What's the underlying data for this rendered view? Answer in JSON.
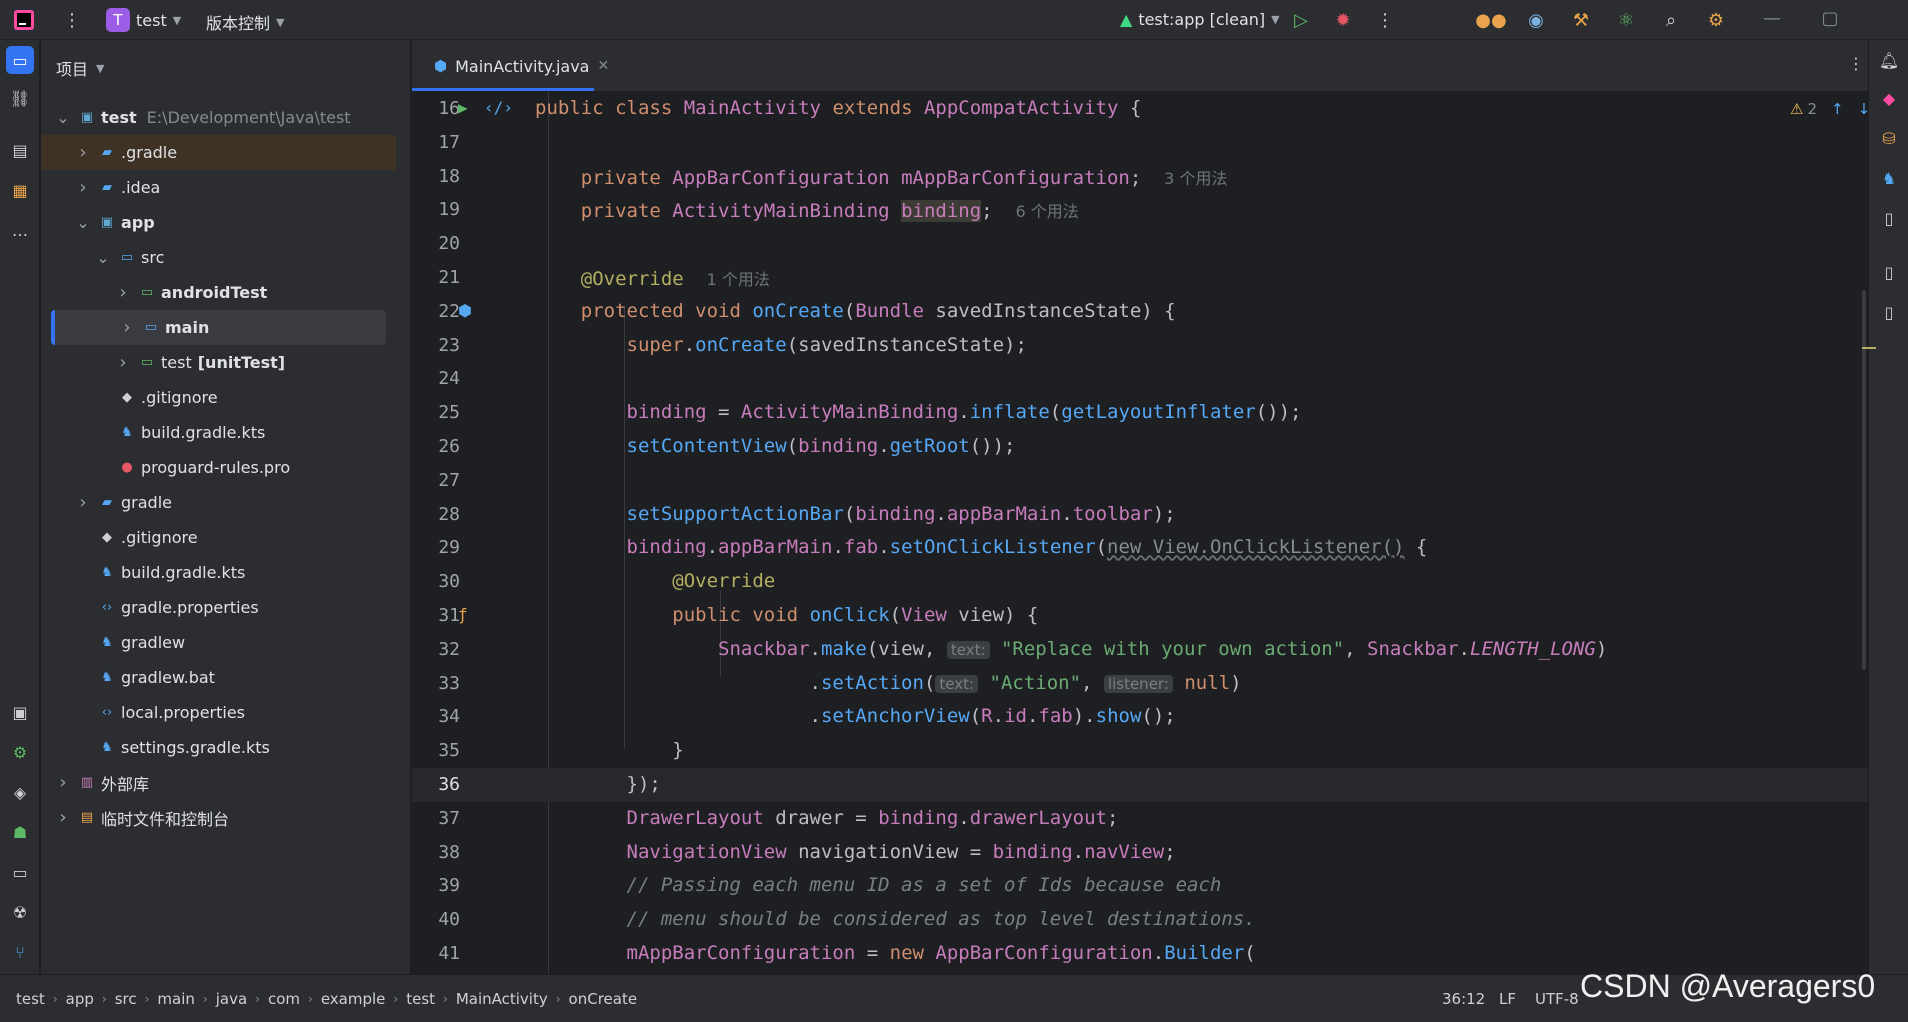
{
  "titlebar": {
    "project_initial": "T",
    "project_name": "test",
    "vcs_label": "版本控制",
    "run_config": "test:app [clean]"
  },
  "project_panel": {
    "title": "项目",
    "rows": [
      {
        "label": "test",
        "hint": "E:\\Development\\Java\\test",
        "depth": 0,
        "expanded": true,
        "bold": true,
        "icon": "module-folder-icon"
      },
      {
        "label": ".gradle",
        "depth": 1,
        "expanded": false,
        "icon": "gradle-folder-icon"
      },
      {
        "label": ".idea",
        "depth": 1,
        "expanded": false,
        "icon": "idea-folder-icon"
      },
      {
        "label": "app",
        "depth": 1,
        "expanded": true,
        "bold": true,
        "icon": "module-folder-icon"
      },
      {
        "label": "src",
        "depth": 2,
        "expanded": true,
        "icon": "source-folder-icon"
      },
      {
        "label": "androidTest",
        "depth": 3,
        "expanded": false,
        "bold": true,
        "icon": "test-folder-icon"
      },
      {
        "label": "main",
        "depth": 3,
        "expanded": false,
        "bold": true,
        "icon": "source-folder-icon"
      },
      {
        "label": "test",
        "hint2": "[unitTest]",
        "depth": 3,
        "expanded": false,
        "icon": "test-folder-icon"
      },
      {
        "label": ".gitignore",
        "depth": 2,
        "icon": "git-file-icon"
      },
      {
        "label": "build.gradle.kts",
        "depth": 2,
        "icon": "gradle-file-icon"
      },
      {
        "label": "proguard-rules.pro",
        "depth": 2,
        "icon": "proguard-file-icon"
      },
      {
        "label": "gradle",
        "depth": 1,
        "expanded": false,
        "icon": "gradle-folder-icon"
      },
      {
        "label": ".gitignore",
        "depth": 1,
        "icon": "git-file-icon"
      },
      {
        "label": "build.gradle.kts",
        "depth": 1,
        "icon": "gradle-file-icon"
      },
      {
        "label": "gradle.properties",
        "depth": 1,
        "icon": "properties-file-icon"
      },
      {
        "label": "gradlew",
        "depth": 1,
        "icon": "gradle-file-icon"
      },
      {
        "label": "gradlew.bat",
        "depth": 1,
        "icon": "gradle-file-icon"
      },
      {
        "label": "local.properties",
        "depth": 1,
        "icon": "properties-file-icon"
      },
      {
        "label": "settings.gradle.kts",
        "depth": 1,
        "icon": "gradle-file-icon"
      },
      {
        "label": "外部库",
        "depth": 0,
        "expanded": false,
        "icon": "library-icon"
      },
      {
        "label": "临时文件和控制台",
        "depth": 0,
        "expanded": false,
        "icon": "scratch-icon"
      }
    ]
  },
  "editor": {
    "tab_label": "MainActivity.java",
    "warning_count": "2",
    "lines": [
      {
        "n": "16",
        "html": "<span class='k'>public class </span><span class='cls'>MainActivity</span><span class='k'> extends </span><span class='cls'>AppCompatActivity</span> {"
      },
      {
        "n": "17",
        "html": ""
      },
      {
        "n": "18",
        "html": "    <span class='k'>private </span><span class='cls'>AppBarConfiguration </span><span class='fld'>mAppBarConfiguration</span>;  <span class='hint'>3 个用法</span>"
      },
      {
        "n": "19",
        "html": "    <span class='k'>private </span><span class='cls'>ActivityMainBinding </span><span class='fld' style='background:#3d3b36'>binding</span>;  <span class='hint'>6 个用法</span>"
      },
      {
        "n": "20",
        "html": ""
      },
      {
        "n": "21",
        "html": "    <span class='an'>@Override</span>  <span class='hint'>1 个用法</span>"
      },
      {
        "n": "22",
        "html": "    <span class='k'>protected void </span><span class='fn'>onCreate</span>(<span class='cls'>Bundle </span>savedInstanceState) {"
      },
      {
        "n": "23",
        "html": "        <span class='k'>super</span>.<span class='fn'>onCreate</span>(savedInstanceState);"
      },
      {
        "n": "24",
        "html": ""
      },
      {
        "n": "25",
        "html": "        <span class='fld'>binding</span> = <span class='cls'>ActivityMainBinding</span>.<span class='fn'>inflate</span>(<span class='fn'>getLayoutInflater</span>());"
      },
      {
        "n": "26",
        "html": "        <span class='fn'>setContentView</span>(<span class='fld'>binding</span>.<span class='fn'>getRoot</span>());"
      },
      {
        "n": "27",
        "html": ""
      },
      {
        "n": "28",
        "html": "        <span class='fn'>setSupportActionBar</span>(<span class='fld'>binding</span>.<span class='fld'>appBarMain</span>.<span class='fld'>toolbar</span>);"
      },
      {
        "n": "29",
        "html": "        <span class='fld'>binding</span>.<span class='fld'>appBarMain</span>.<span class='fld'>fab</span>.<span class='fn'>setOnClickListener</span>(<span style='color:#868a91;text-decoration:underline wavy #6a6d73'>new View.OnClickListener()</span> {"
      },
      {
        "n": "30",
        "html": "            <span class='an'>@Override</span>"
      },
      {
        "n": "31",
        "html": "            <span class='k'>public void </span><span class='fn'>onClick</span>(<span class='cls'>View </span>view) {"
      },
      {
        "n": "32",
        "html": "                <span class='cls'>Snackbar</span>.<span class='fn'>make</span>(view, <span class='inlay'>text:</span> <span class='s'>\"Replace with your own action\"</span>, <span class='cls'>Snackbar</span>.<span class='fld it'>LENGTH_LONG</span>)"
      },
      {
        "n": "33",
        "html": "                        .<span class='fn'>setAction</span>(<span class='inlay'>text:</span> <span class='s'>\"Action\"</span>, <span class='inlay'>listener:</span> <span class='k'>null</span>)"
      },
      {
        "n": "34",
        "html": "                        .<span class='fn'>setAnchorView</span>(<span class='cls'>R</span>.<span class='cls'>id</span>.<span class='fld'>fab</span>).<span class='fn'>show</span>();"
      },
      {
        "n": "35",
        "html": "            }"
      },
      {
        "n": "36",
        "html": "        });"
      },
      {
        "n": "37",
        "html": "        <span class='cls'>DrawerLayout </span>drawer = <span class='fld'>binding</span>.<span class='fld'>drawerLayout</span>;"
      },
      {
        "n": "38",
        "html": "        <span class='cls'>NavigationView </span>navigationView = <span class='fld'>binding</span>.<span class='fld'>navView</span>;"
      },
      {
        "n": "39",
        "html": "        <span class='cm'>// Passing each menu ID as a set of Ids because each</span>"
      },
      {
        "n": "40",
        "html": "        <span class='cm'>// menu should be considered as top level destinations.</span>"
      },
      {
        "n": "41",
        "html": "        <span class='fld'>mAppBarConfiguration</span> = <span class='k'>new </span><span class='cls'>AppBarConfiguration</span>.<span class='fn'>Builder</span>("
      }
    ],
    "current_line": "36"
  },
  "statusbar": {
    "crumbs": [
      "test",
      "app",
      "src",
      "main",
      "java",
      "com",
      "example",
      "test",
      "MainActivity",
      "onCreate"
    ],
    "position": "36:12",
    "line_sep": "LF",
    "encoding": "UTF-8"
  },
  "watermark": "CSDN @Averagers0",
  "colors": {
    "accent": "#3574f0",
    "bg": "#1e1f22",
    "panel": "#2b2d30"
  }
}
